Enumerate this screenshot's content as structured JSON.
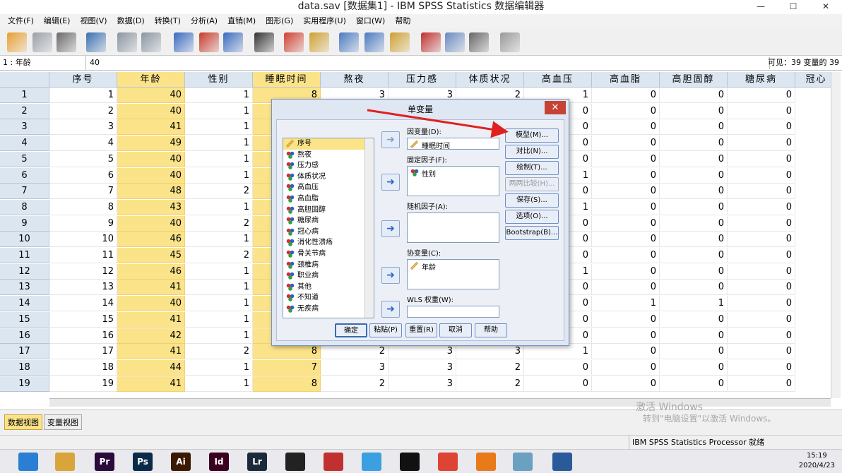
{
  "window": {
    "title": "data.sav [数据集1] - IBM SPSS Statistics 数据编辑器",
    "minimize": "—",
    "maximize": "☐",
    "close": "✕"
  },
  "menu": [
    "文件(F)",
    "编辑(E)",
    "视图(V)",
    "数据(D)",
    "转换(T)",
    "分析(A)",
    "直销(M)",
    "图形(G)",
    "实用程序(U)",
    "窗口(W)",
    "帮助"
  ],
  "toolbar_icons": [
    "open-icon",
    "save-icon",
    "print-icon",
    "recall-dialog-icon",
    "undo-icon",
    "redo-icon",
    "goto-case-icon",
    "goto-variable-icon",
    "variables-icon",
    "find-icon",
    "insert-cases-icon",
    "insert-variable-icon",
    "split-file-icon",
    "weight-cases-icon",
    "select-cases-icon",
    "value-labels-icon",
    "use-sets-icon",
    "show-all-variables-icon",
    "spell-check-icon"
  ],
  "cellbar": {
    "cell_name": "1 : 年龄",
    "cell_value": "40",
    "visible": "可见：39 变量的 39"
  },
  "grid": {
    "columns": [
      "序号",
      "年龄",
      "性别",
      "睡眠时间",
      "熬夜",
      "压力感",
      "体质状况",
      "高血压",
      "高血脂",
      "高胆固醇",
      "糖尿病",
      "冠心"
    ],
    "highlighted_columns": [
      1,
      3
    ],
    "rows": [
      [
        "1",
        "1",
        "40",
        "1",
        "8",
        "3",
        "3",
        "2",
        "1",
        "0",
        "0",
        "0"
      ],
      [
        "2",
        "2",
        "40",
        "1",
        "",
        "",
        "",
        "",
        "0",
        "0",
        "0",
        "0"
      ],
      [
        "3",
        "3",
        "41",
        "1",
        "",
        "",
        "",
        "",
        "0",
        "0",
        "0",
        "0"
      ],
      [
        "4",
        "4",
        "49",
        "1",
        "",
        "",
        "",
        "",
        "0",
        "0",
        "0",
        "0"
      ],
      [
        "5",
        "5",
        "40",
        "1",
        "",
        "",
        "",
        "",
        "0",
        "0",
        "0",
        "0"
      ],
      [
        "6",
        "6",
        "40",
        "1",
        "",
        "",
        "",
        "",
        "1",
        "0",
        "0",
        "0"
      ],
      [
        "7",
        "7",
        "48",
        "2",
        "",
        "",
        "",
        "",
        "0",
        "0",
        "0",
        "0"
      ],
      [
        "8",
        "8",
        "43",
        "1",
        "",
        "",
        "",
        "",
        "1",
        "0",
        "0",
        "0"
      ],
      [
        "9",
        "9",
        "40",
        "2",
        "",
        "",
        "",
        "",
        "0",
        "0",
        "0",
        "0"
      ],
      [
        "10",
        "10",
        "46",
        "1",
        "",
        "",
        "",
        "",
        "0",
        "0",
        "0",
        "0"
      ],
      [
        "11",
        "11",
        "45",
        "2",
        "",
        "",
        "",
        "",
        "0",
        "0",
        "0",
        "0"
      ],
      [
        "12",
        "12",
        "46",
        "1",
        "",
        "",
        "",
        "",
        "1",
        "0",
        "0",
        "0"
      ],
      [
        "13",
        "13",
        "41",
        "1",
        "",
        "",
        "",
        "",
        "0",
        "0",
        "0",
        "0"
      ],
      [
        "14",
        "14",
        "40",
        "1",
        "",
        "",
        "",
        "",
        "0",
        "1",
        "1",
        "0"
      ],
      [
        "15",
        "15",
        "41",
        "1",
        "",
        "",
        "",
        "",
        "0",
        "0",
        "0",
        "0"
      ],
      [
        "16",
        "16",
        "42",
        "1",
        "",
        "",
        "",
        "",
        "0",
        "0",
        "0",
        "0"
      ],
      [
        "17",
        "17",
        "41",
        "2",
        "8",
        "2",
        "3",
        "3",
        "1",
        "0",
        "0",
        "0"
      ],
      [
        "18",
        "18",
        "44",
        "1",
        "7",
        "3",
        "3",
        "2",
        "0",
        "0",
        "0",
        "0"
      ],
      [
        "19",
        "19",
        "41",
        "1",
        "8",
        "2",
        "3",
        "2",
        "0",
        "0",
        "0",
        "0"
      ]
    ]
  },
  "view_tabs": [
    "数据视图",
    "变量视图"
  ],
  "status": {
    "processor": "IBM SPSS Statistics Processor 就绪"
  },
  "activation_watermark": {
    "line1": "激活 Windows",
    "line2": "转到\"电脑设置\"以激活 Windows。"
  },
  "dialog": {
    "title": "单变量",
    "variables": [
      "序号",
      "熬夜",
      "压力感",
      "体质状况",
      "高血压",
      "高血脂",
      "高胆固醇",
      "糖尿病",
      "冠心病",
      "消化性溃疡",
      "骨关节病",
      "颈椎病",
      "职业病",
      "其他",
      "不知道",
      "无疾病"
    ],
    "selected_variable": 0,
    "dependent_label": "因变量(D):",
    "dependent_value": "睡眠时间",
    "fixed_label": "固定因子(F):",
    "fixed_items": [
      "性别"
    ],
    "random_label": "随机因子(A):",
    "covariate_label": "协变量(C):",
    "covariate_items": [
      "年龄"
    ],
    "wls_label": "WLS 权重(W):",
    "right_buttons": [
      "模型(M)...",
      "对比(N)...",
      "绘制(T)...",
      "两两比较(H)...",
      "保存(S)...",
      "选项(O)...",
      "Bootstrap(B)..."
    ],
    "disabled_right": [
      3
    ],
    "bottom_buttons": [
      "确定",
      "粘贴(P)",
      "重置(R)",
      "取消",
      "帮助"
    ]
  },
  "taskbar": {
    "apps": [
      {
        "label": "",
        "color": "#2a7fd4",
        "icon": "ie-icon"
      },
      {
        "label": "",
        "color": "#d9a53a",
        "icon": "explorer-icon"
      },
      {
        "label": "Pr",
        "color": "#2a0b3c",
        "icon": "premiere-icon"
      },
      {
        "label": "Ps",
        "color": "#0a2a4a",
        "icon": "photoshop-icon"
      },
      {
        "label": "Ai",
        "color": "#3a1a00",
        "icon": "illustrator-icon"
      },
      {
        "label": "Id",
        "color": "#3a0020",
        "icon": "indesign-icon"
      },
      {
        "label": "Lr",
        "color": "#1a2a3a",
        "icon": "lightroom-icon"
      },
      {
        "label": "",
        "color": "#222",
        "icon": "film-icon"
      },
      {
        "label": "",
        "color": "#c03030",
        "icon": "wps-icon"
      },
      {
        "label": "",
        "color": "#3aa0e0",
        "icon": "bird-icon"
      },
      {
        "label": "",
        "color": "#111",
        "icon": "qq-icon"
      },
      {
        "label": "",
        "color": "#dd4433",
        "icon": "chrome-icon"
      },
      {
        "label": "",
        "color": "#e87a1a",
        "icon": "firefox-icon"
      },
      {
        "label": "",
        "color": "#6aa0c0",
        "icon": "blocks-icon"
      },
      {
        "label": "",
        "color": "#2a5a9a",
        "icon": "spss-icon"
      }
    ],
    "time": "15:19",
    "date": "2020/4/23"
  }
}
